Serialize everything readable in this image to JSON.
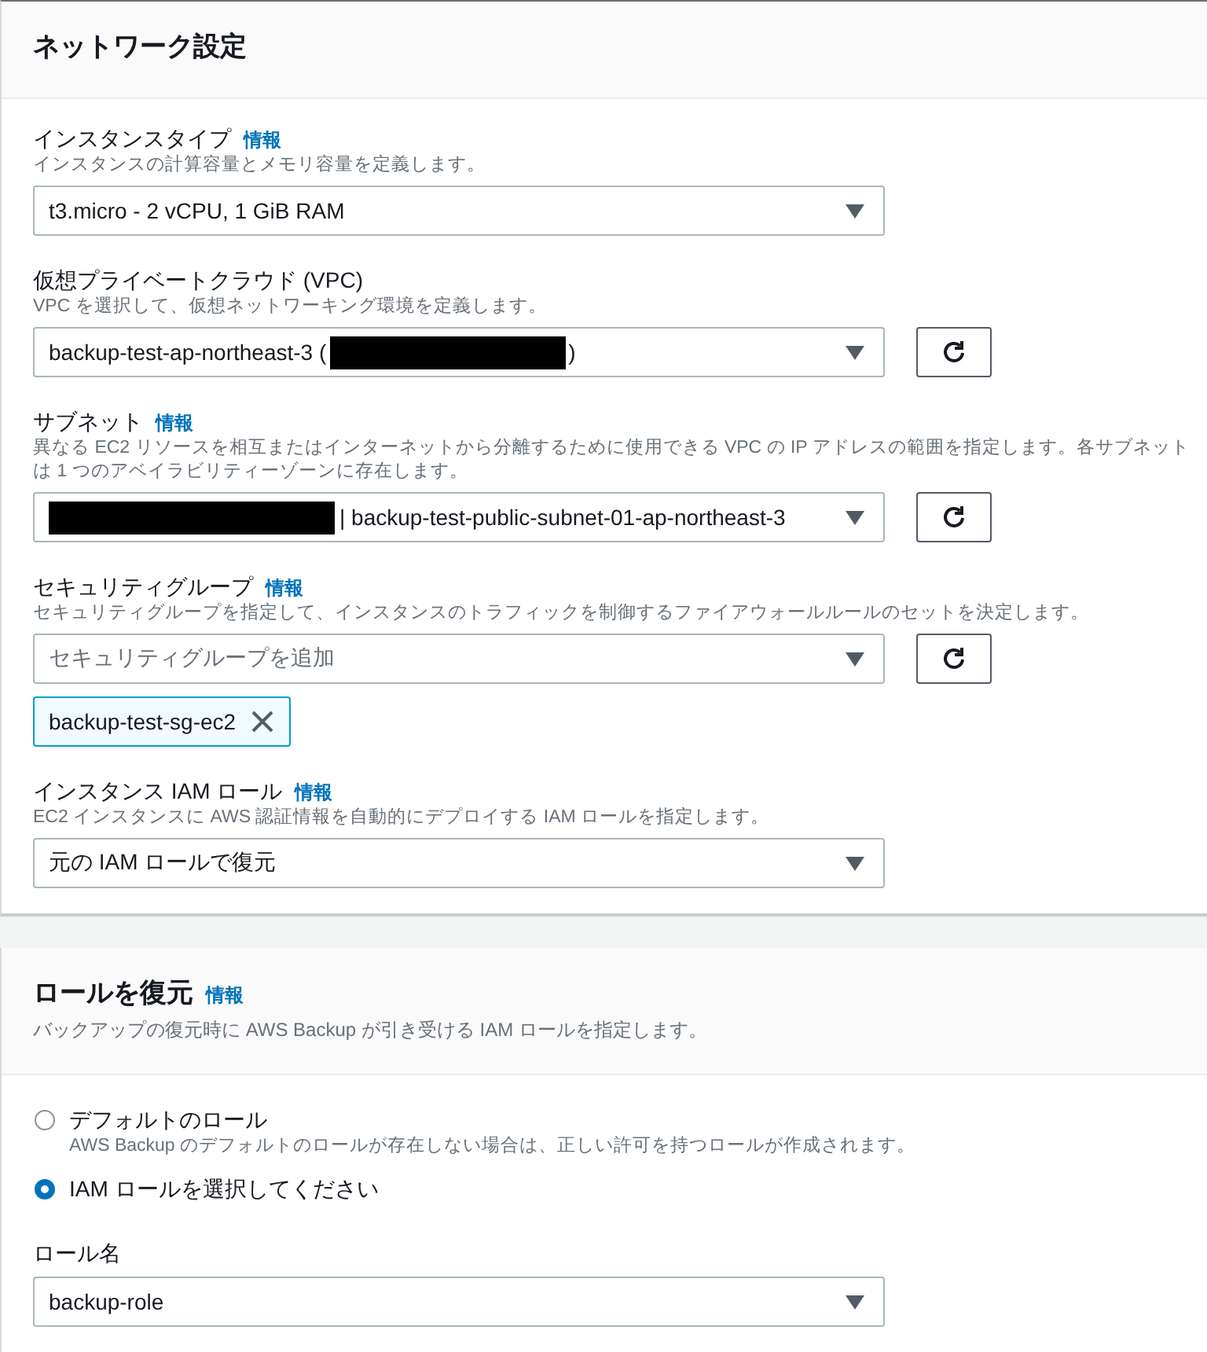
{
  "sections": [
    {
      "title": "ネットワーク設定",
      "fields": [
        {
          "label": "インスタンスタイプ",
          "info": "情報",
          "description": "インスタンスの計算容量とメモリ容量を定義します。",
          "value": [
            {
              "kind": "text",
              "text": "t3.micro - 2 vCPU, 1 GiB RAM"
            }
          ],
          "refresh": false
        },
        {
          "label": "仮想プライベートクラウド (VPC)",
          "description": "VPC を選択して、仮想ネットワーキング環境を定義します。",
          "value": [
            {
              "kind": "text",
              "text": "backup-test-ap-northeast-3 ("
            },
            {
              "kind": "redacted"
            },
            {
              "kind": "text",
              "text": ")"
            }
          ],
          "refresh": true
        },
        {
          "label": "サブネット",
          "info": "情報",
          "description": "異なる EC2 リソースを相互またはインターネットから分離するために使用できる VPC の IP アドレスの範囲を指定します。各サブネットは 1 つのアベイラビリティーゾーンに存在します。",
          "value": [
            {
              "kind": "redacted"
            },
            {
              "kind": "text",
              "text": "| backup-test-public-subnet-01-ap-northeast-3"
            }
          ],
          "refresh": true
        },
        {
          "label": "セキュリティグループ",
          "info": "情報",
          "description": "セキュリティグループを指定して、インスタンスのトラフィックを制御するファイアウォールルールのセットを決定します。",
          "placeholder": "セキュリティグループを追加",
          "refresh": true,
          "tokens": [
            {
              "text": "backup-test-sg-ec2"
            }
          ]
        },
        {
          "label": "インスタンス IAM ロール",
          "info": "情報",
          "description": "EC2 インスタンスに AWS 認証情報を自動的にデプロイする IAM ロールを指定します。",
          "value": [
            {
              "kind": "text",
              "text": "元の IAM ロールで復元"
            }
          ],
          "refresh": false
        }
      ]
    },
    {
      "title": "ロールを復元",
      "info": "情報",
      "description": "バックアップの復元時に AWS Backup が引き受ける IAM ロールを指定します。",
      "options": [
        {
          "label": "デフォルトのロール",
          "description": "AWS Backup のデフォルトのロールが存在しない場合は、正しい許可を持つロールが作成されます。",
          "selected": false
        },
        {
          "label": "IAM ロールを選択してください",
          "selected": true
        }
      ],
      "fields": [
        {
          "label": "ロール名",
          "value": [
            {
              "kind": "text",
              "text": "backup-role"
            }
          ],
          "refresh": false
        }
      ]
    }
  ]
}
